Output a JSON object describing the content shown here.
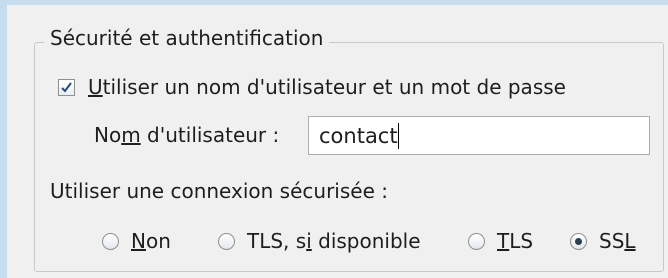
{
  "security": {
    "group_title": "Sécurité et authentification",
    "use_credentials": {
      "checked": true,
      "label_pre": "",
      "label_key": "U",
      "label_post": "tiliser un nom d'utilisateur et un mot de passe"
    },
    "username": {
      "label_pre": "No",
      "label_key": "m",
      "label_post": " d'utilisateur :",
      "value": "contact"
    },
    "connection_label": "Utiliser une connexion sécurisée :",
    "options": [
      {
        "pre": "",
        "key": "N",
        "post": "on",
        "selected": false
      },
      {
        "pre": "TLS, s",
        "key": "i",
        "post": " disponible",
        "selected": false
      },
      {
        "pre": "",
        "key": "T",
        "post": "LS",
        "selected": false
      },
      {
        "pre": "SS",
        "key": "L",
        "post": "",
        "selected": true
      }
    ]
  },
  "icons": {
    "checkbox": "checkmark-icon",
    "radio": "radio-dot-icon"
  },
  "colors": {
    "window_border": "#c6dcef",
    "check": "#2b4a7a",
    "background": "#f0f0f0"
  }
}
